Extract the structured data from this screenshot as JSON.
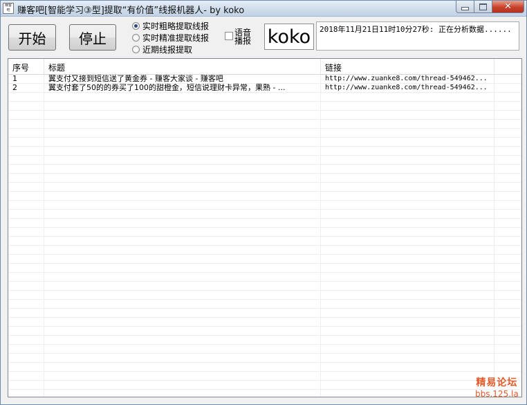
{
  "window": {
    "title": "赚客吧[智能学习③型]提取“有价值”线报机器人- by koko",
    "icon_text": "赚客吧"
  },
  "toolbar": {
    "start_label": "开始",
    "stop_label": "停止",
    "koko_label": "koko",
    "voice_label": "语音播报",
    "voice_checked": false
  },
  "modes": [
    {
      "label": "实时粗略提取线报",
      "checked": true
    },
    {
      "label": "实时精准提取线报",
      "checked": false
    },
    {
      "label": "近期线报提取",
      "checked": false
    }
  ],
  "status": {
    "text": "2018年11月21日11时10分27秒: 正在分析数据......"
  },
  "table": {
    "columns": [
      "序号",
      "标题",
      "链接"
    ],
    "rows": [
      {
        "index": "1",
        "title": "翼支付又接到短信送了黄金券 - 赚客大家谈 -  赚客吧",
        "link": "http://www.zuanke8.com/thread-549462..."
      },
      {
        "index": "2",
        "title": "翼支付套了50的的券买了100的甜橙金，短信说理财卡异常，果熟 - ...",
        "link": "http://www.zuanke8.com/thread-549462..."
      }
    ],
    "empty_rows": 36
  },
  "watermark": {
    "line1": "精易论坛",
    "line2": "bbs.125.la"
  }
}
